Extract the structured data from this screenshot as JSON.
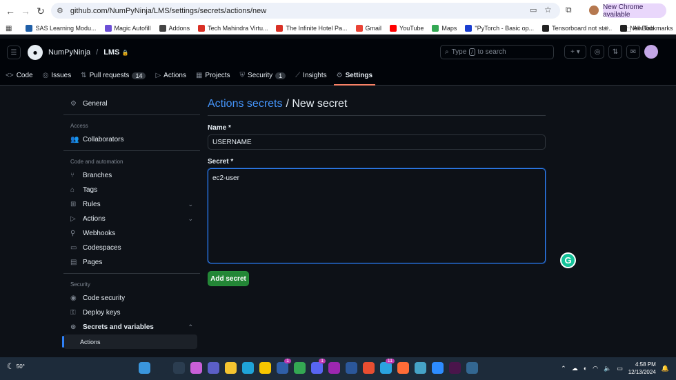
{
  "browser": {
    "url": "github.com/NumPyNinja/LMS/settings/secrets/actions/new",
    "update_label": "New Chrome available",
    "bookmarks": [
      {
        "label": "SAS Learning Modu...",
        "color": "#1f5fa8"
      },
      {
        "label": "Magic Autofill",
        "color": "#6c4fd6"
      },
      {
        "label": "Addons",
        "color": "#444444"
      },
      {
        "label": "Tech Mahindra Virtu...",
        "color": "#d93025"
      },
      {
        "label": "The Infinite Hotel Pa...",
        "color": "#d93025"
      },
      {
        "label": "Gmail",
        "color": "#ea4335"
      },
      {
        "label": "YouTube",
        "color": "#ff0000"
      },
      {
        "label": "Maps",
        "color": "#34a853"
      },
      {
        "label": "\"PyTorch - Basic op...",
        "color": "#1a3ed0"
      },
      {
        "label": "Tensorboard not sta...",
        "color": "#222222"
      },
      {
        "label": "New Tab",
        "color": "#222222"
      }
    ],
    "all_bookmarks": "All Bookmarks",
    "bookmarks_more": "»"
  },
  "header": {
    "org": "NumPyNinja",
    "separator": "/",
    "repo": "LMS",
    "lock": "🔒",
    "search_prefix": "Type",
    "search_key": "/",
    "search_suffix": "to search"
  },
  "repo_nav": [
    {
      "label": "Code",
      "icon": "code-icon",
      "glyph": "<>",
      "counter": ""
    },
    {
      "label": "Issues",
      "icon": "issue-icon",
      "glyph": "◎",
      "counter": ""
    },
    {
      "label": "Pull requests",
      "icon": "pull-request-icon",
      "glyph": "⇅",
      "counter": "14"
    },
    {
      "label": "Actions",
      "icon": "play-icon",
      "glyph": "▷",
      "counter": ""
    },
    {
      "label": "Projects",
      "icon": "table-icon",
      "glyph": "▦",
      "counter": ""
    },
    {
      "label": "Security",
      "icon": "shield-icon",
      "glyph": "⛨",
      "counter": "1"
    },
    {
      "label": "Insights",
      "icon": "graph-icon",
      "glyph": "⟋",
      "counter": ""
    },
    {
      "label": "Settings",
      "icon": "gear-icon",
      "glyph": "⚙",
      "counter": "",
      "active": true
    }
  ],
  "sidebar": {
    "general": "General",
    "access_heading": "Access",
    "collaborators": "Collaborators",
    "code_heading": "Code and automation",
    "branches": "Branches",
    "tags": "Tags",
    "rules": "Rules",
    "actions": "Actions",
    "webhooks": "Webhooks",
    "codespaces": "Codespaces",
    "pages": "Pages",
    "security_heading": "Security",
    "code_security": "Code security",
    "deploy_keys": "Deploy keys",
    "secrets_and_variables": "Secrets and variables",
    "actions_sub": "Actions"
  },
  "form": {
    "title_link": "Actions secrets",
    "title_rest": "/ New secret",
    "name_label": "Name *",
    "name_value": "USERNAME",
    "secret_label": "Secret *",
    "secret_value": "ec2-user",
    "submit_label": "Add secret"
  },
  "grammarly": "G",
  "taskbar": {
    "temperature": "50°",
    "time": "4:58 PM",
    "date": "12/13/2024",
    "apps": [
      {
        "name": "windows-start-icon",
        "color": "#3a96dd",
        "badge": ""
      },
      {
        "name": "search-icon",
        "color": "#1d2b3a",
        "badge": ""
      },
      {
        "name": "task-view-icon",
        "color": "#2b3d50",
        "badge": ""
      },
      {
        "name": "copilot-icon",
        "color": "#c85fd8",
        "badge": ""
      },
      {
        "name": "teams-icon",
        "color": "#5b5fc7",
        "badge": ""
      },
      {
        "name": "file-explorer-icon",
        "color": "#f4c430",
        "badge": ""
      },
      {
        "name": "edge-icon",
        "color": "#1fa3d8",
        "badge": ""
      },
      {
        "name": "norton-icon",
        "color": "#f7c600",
        "badge": ""
      },
      {
        "name": "app-l-icon",
        "color": "#2f5fa8",
        "badge": "1"
      },
      {
        "name": "chrome-icon",
        "color": "#34a853",
        "badge": ""
      },
      {
        "name": "discord-icon",
        "color": "#5865f2",
        "badge": "1"
      },
      {
        "name": "intellij-icon",
        "color": "#9c27b0",
        "badge": ""
      },
      {
        "name": "word-icon",
        "color": "#2b579a",
        "badge": ""
      },
      {
        "name": "git-icon",
        "color": "#e94e31",
        "badge": ""
      },
      {
        "name": "telegram-icon",
        "color": "#2aa3e0",
        "badge": "11"
      },
      {
        "name": "postman-icon",
        "color": "#ff6c37",
        "badge": ""
      },
      {
        "name": "app-globe-icon",
        "color": "#46a3c7",
        "badge": ""
      },
      {
        "name": "zoom-icon",
        "color": "#2d8cff",
        "badge": ""
      },
      {
        "name": "slack-icon",
        "color": "#4a154b",
        "badge": ""
      },
      {
        "name": "postgres-icon",
        "color": "#336791",
        "badge": ""
      }
    ]
  }
}
